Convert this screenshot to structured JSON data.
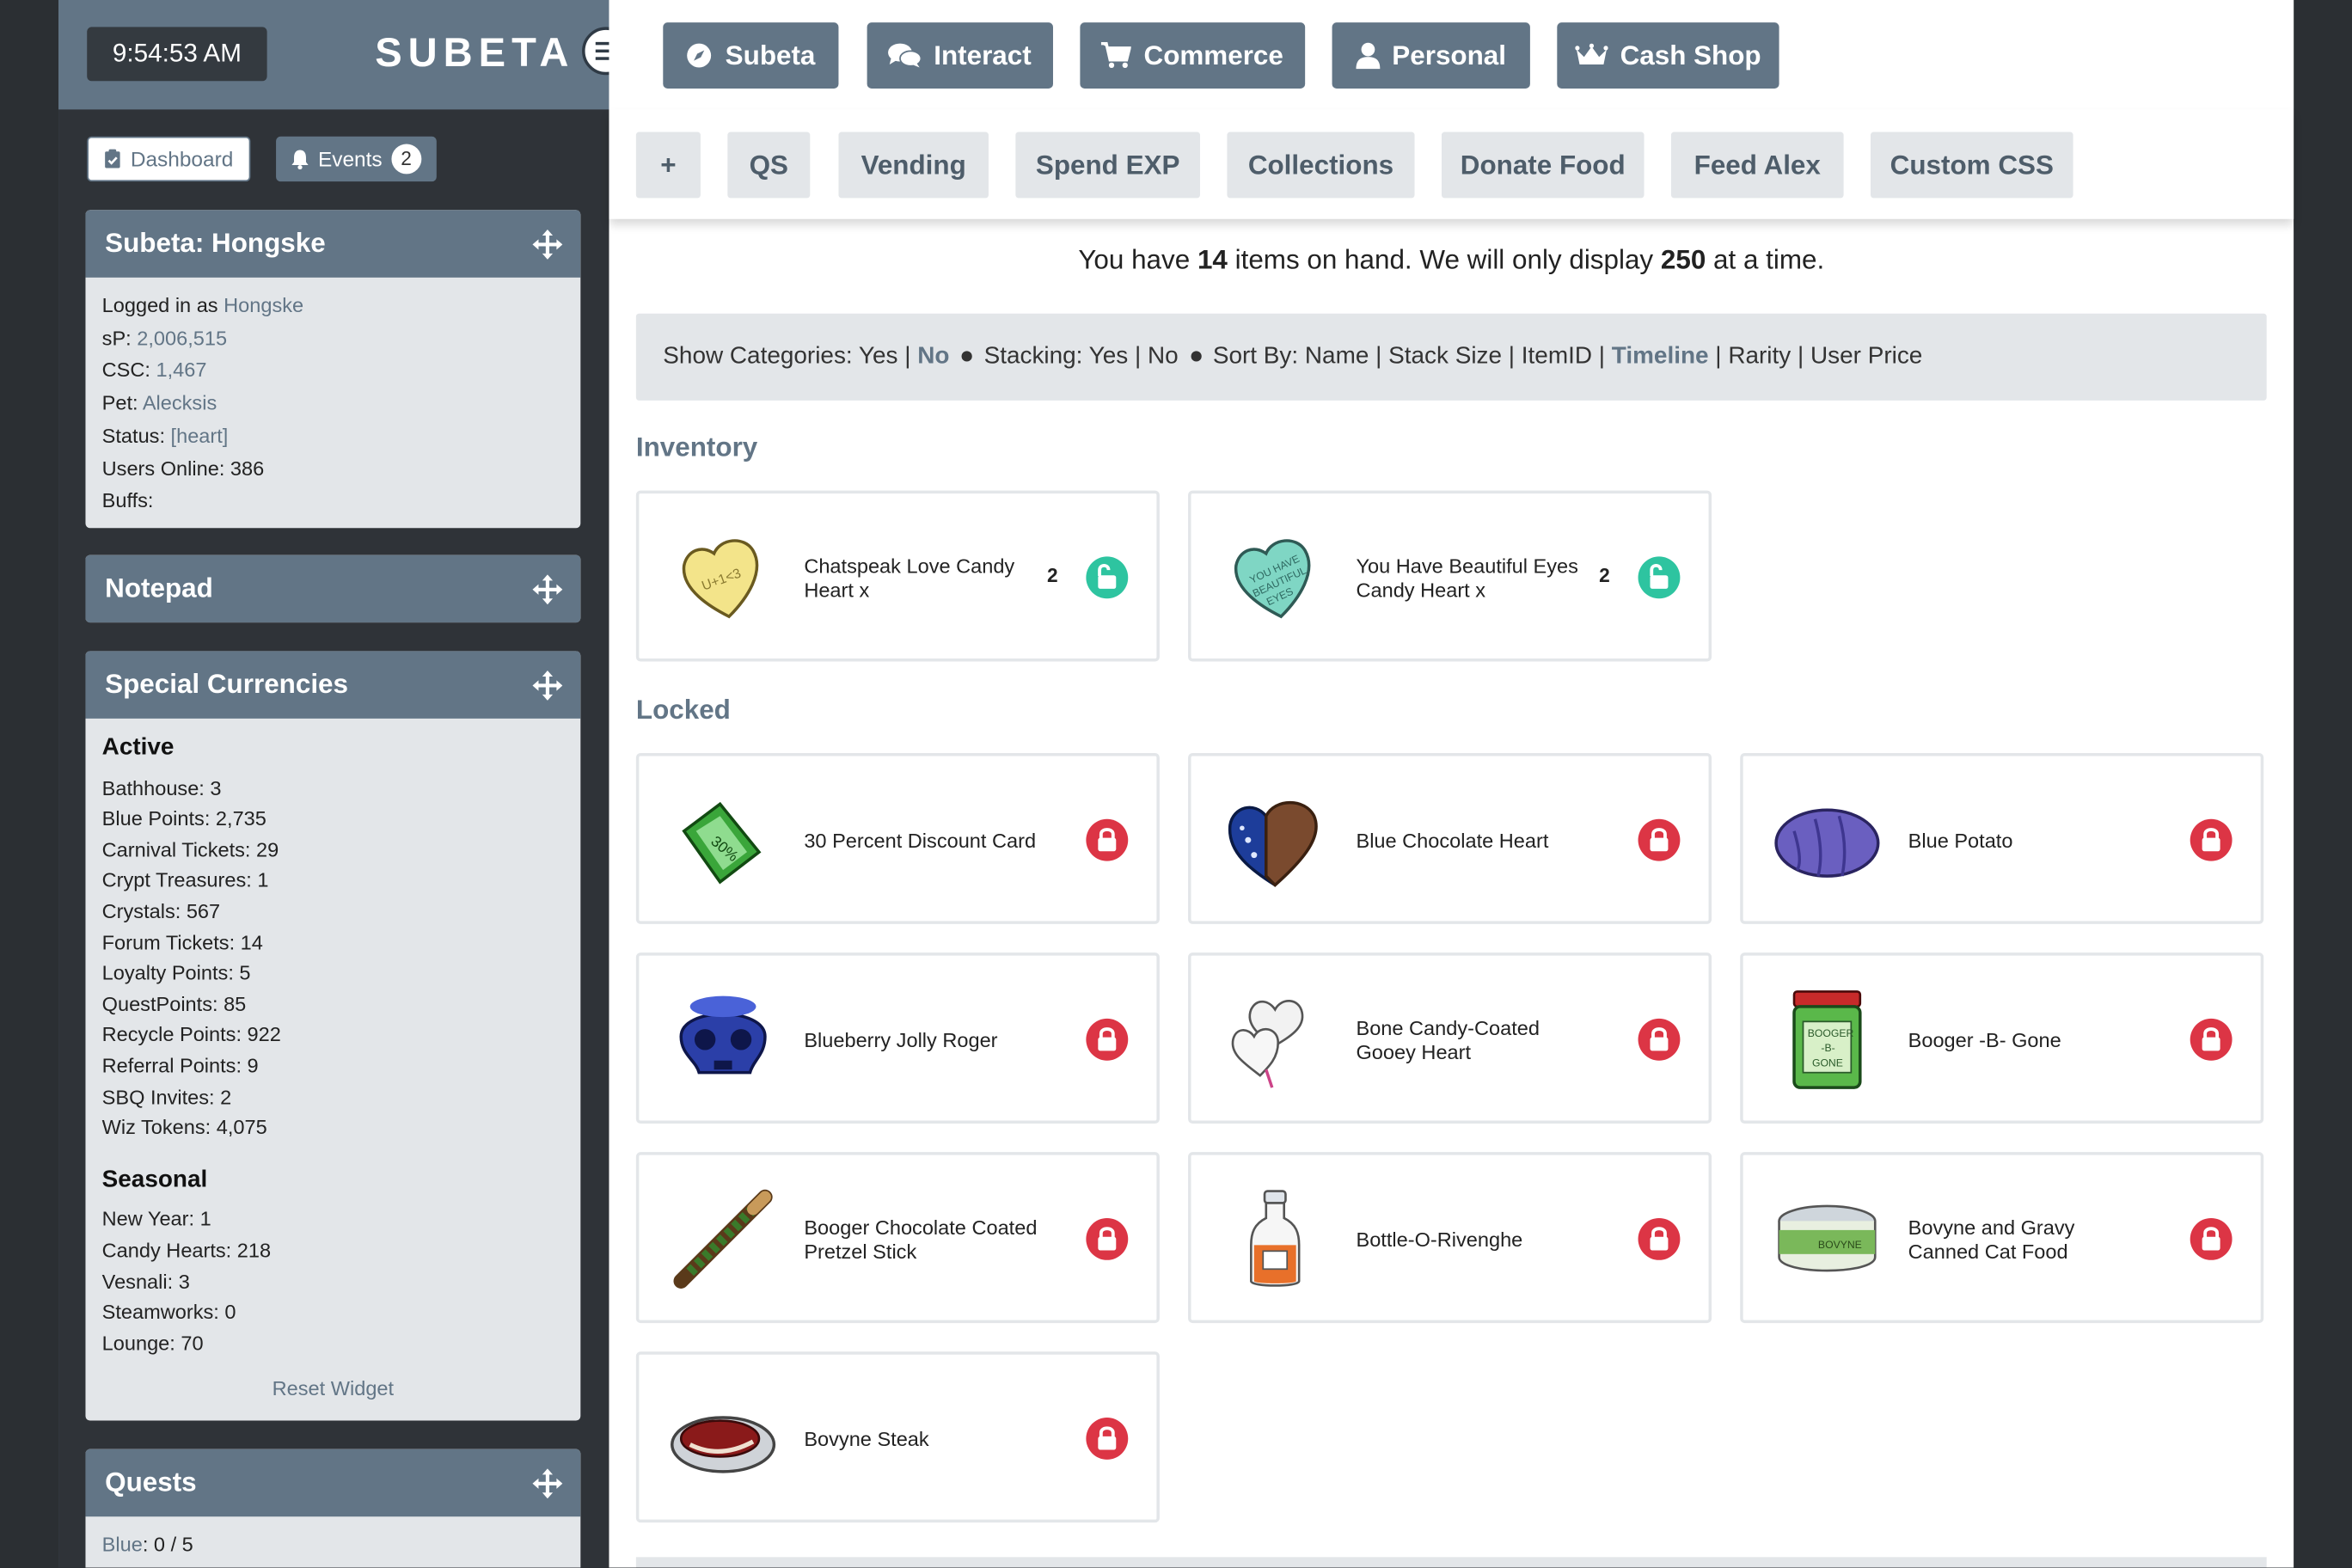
{
  "clock": "9:54:53 AM",
  "brand": "SUBETA",
  "nav": [
    {
      "label": "Subeta",
      "icon": "compass-icon"
    },
    {
      "label": "Interact",
      "icon": "chat-icon"
    },
    {
      "label": "Commerce",
      "icon": "cart-icon"
    },
    {
      "label": "Personal",
      "icon": "user-icon"
    },
    {
      "label": "Cash Shop",
      "icon": "crown-icon"
    }
  ],
  "subnav": [
    "+",
    "QS",
    "Vending",
    "Spend EXP",
    "Collections",
    "Donate Food",
    "Feed Alex",
    "Custom CSS"
  ],
  "leftbar": {
    "dashboard_label": "Dashboard",
    "events_label": "Events",
    "events_count": "2"
  },
  "panel_subeta": {
    "title": "Subeta: Hongske",
    "logged_label": "Logged in as ",
    "logged_user": "Hongske",
    "sp_label": "sP: ",
    "sp_value": "2,006,515",
    "csc_label": "CSC: ",
    "csc_value": "1,467",
    "pet_label": "Pet: ",
    "pet_value": "Alecksis",
    "status_label": "Status: ",
    "status_value": "[heart]",
    "users_online": "Users Online: 386",
    "buffs": "Buffs:"
  },
  "panel_notepad": {
    "title": "Notepad"
  },
  "panel_currencies": {
    "title": "Special Currencies",
    "active_heading": "Active",
    "active": [
      "Bathhouse: 3",
      "Blue Points: 2,735",
      "Carnival Tickets: 29",
      "Crypt Treasures: 1",
      "Crystals: 567",
      "Forum Tickets: 14",
      "Loyalty Points: 5",
      "QuestPoints: 85",
      "Recycle Points: 922",
      "Referral Points: 9",
      "SBQ Invites: 2",
      "Wiz Tokens: 4,075"
    ],
    "seasonal_heading": "Seasonal",
    "seasonal": [
      "New Year: 1",
      "Candy Hearts: 218",
      "Vesnali: 3",
      "Steamworks: 0",
      "Lounge: 70"
    ],
    "reset": "Reset Widget"
  },
  "panel_quests": {
    "title": "Quests",
    "blue_label": "Blue",
    "blue_value": ": 0 / 5"
  },
  "notice": {
    "pre": "You have ",
    "count": "14",
    "mid": " items on hand. We will only display ",
    "limit": "250",
    "post": " at a time."
  },
  "options": {
    "cat_label": "Show Categories: Yes | ",
    "cat_active": "No",
    "stack": "Stacking: Yes | No",
    "sort_pre": "Sort By: Name | Stack Size | ItemID | ",
    "sort_active": "Timeline",
    "sort_post": " | Rarity | User Price"
  },
  "inventory_heading": "Inventory",
  "locked_heading": "Locked",
  "inventory": [
    {
      "name": "Chatspeak Love Candy Heart x",
      "qty": "2",
      "icon": "yellow-candy-heart-icon",
      "lock": "unlocked"
    },
    {
      "name": "You Have Beautiful Eyes Candy Heart x",
      "qty": "2",
      "icon": "teal-candy-heart-icon",
      "lock": "unlocked"
    }
  ],
  "locked": [
    {
      "name": "30 Percent Discount Card",
      "icon": "discount-card-icon"
    },
    {
      "name": "Blue Chocolate Heart",
      "icon": "blue-chocolate-heart-icon"
    },
    {
      "name": "Blue Potato",
      "icon": "blue-potato-icon"
    },
    {
      "name": "Blueberry Jolly Roger",
      "icon": "blue-skull-candy-icon"
    },
    {
      "name": "Bone Candy-Coated Gooey Heart",
      "icon": "bone-hearts-icon"
    },
    {
      "name": "Booger -B- Gone",
      "icon": "jar-icon"
    },
    {
      "name": "Booger Chocolate Coated Pretzel Stick",
      "icon": "pretzel-stick-icon"
    },
    {
      "name": "Bottle-O-Rivenghe",
      "icon": "bottle-icon"
    },
    {
      "name": "Bovyne and Gravy Canned Cat Food",
      "icon": "cat-food-can-icon"
    },
    {
      "name": "Bovyne Steak",
      "icon": "steak-icon"
    }
  ],
  "colors": {
    "accent": "#627586",
    "unlocked": "#2ec4a0",
    "locked": "#dc3545"
  }
}
